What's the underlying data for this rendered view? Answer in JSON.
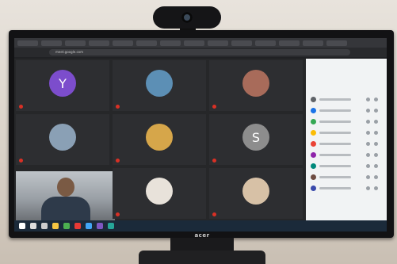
{
  "monitor": {
    "brand": "acer"
  },
  "browser": {
    "url": "meet.google.com"
  },
  "tiles": [
    {
      "kind": "letter",
      "letter": "Y",
      "color": "#7c4dcc",
      "name": ""
    },
    {
      "kind": "photo",
      "color": "#5c8fb5",
      "name": ""
    },
    {
      "kind": "photo",
      "color": "#a86b5a",
      "name": ""
    },
    {
      "kind": "photo",
      "color": "#8aa0b5",
      "name": ""
    },
    {
      "kind": "photo",
      "color": "#d6a64a",
      "name": ""
    },
    {
      "kind": "letter",
      "letter": "S",
      "color": "#8d8d8d",
      "name": ""
    },
    {
      "kind": "self",
      "color": "#9aa0a6",
      "name": ""
    },
    {
      "kind": "photo",
      "color": "#e8e2da",
      "name": ""
    },
    {
      "kind": "photo",
      "color": "#d7c1a6",
      "name": ""
    }
  ],
  "panel": {
    "title": "",
    "rows": [
      {
        "color": "#5f6368"
      },
      {
        "color": "#1a73e8"
      },
      {
        "color": "#34a853"
      },
      {
        "color": "#fbbc04"
      },
      {
        "color": "#ea4335"
      },
      {
        "color": "#8e24aa"
      },
      {
        "color": "#00897b"
      },
      {
        "color": "#6d4c41"
      },
      {
        "color": "#3949ab"
      }
    ]
  },
  "taskbar": {
    "icons": [
      "start-icon",
      "search-icon",
      "task-view-icon",
      "explorer-icon",
      "chrome-icon",
      "app-icon",
      "app-icon",
      "app-icon",
      "app-icon"
    ]
  }
}
